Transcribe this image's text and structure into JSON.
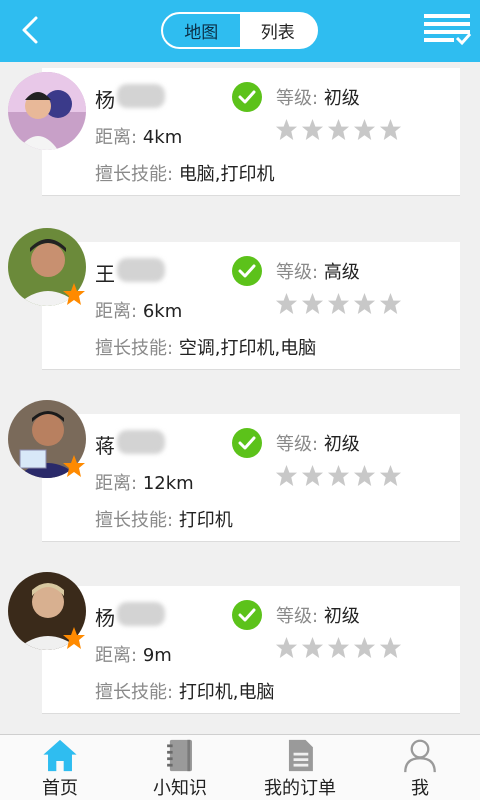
{
  "header": {
    "segments": [
      {
        "label": "地图",
        "active": true
      },
      {
        "label": "列表",
        "active": false
      }
    ],
    "accent_color": "#2fbdf0"
  },
  "technicians": [
    {
      "name_prefix": "杨",
      "name_blurred": true,
      "level_label": "等级:",
      "level": "初级",
      "distance_label": "距离:",
      "distance": "4km",
      "rating": 0,
      "skills_label": "擅长技能:",
      "skills": "电脑,打印机",
      "starred": false
    },
    {
      "name_prefix": "王",
      "name_blurred": true,
      "level_label": "等级:",
      "level": "高级",
      "distance_label": "距离:",
      "distance": "6km",
      "rating": 0,
      "skills_label": "擅长技能:",
      "skills": "空调,打印机,电脑",
      "starred": true
    },
    {
      "name_prefix": "蒋",
      "name_blurred": true,
      "level_label": "等级:",
      "level": "初级",
      "distance_label": "距离:",
      "distance": "12km",
      "rating": 0,
      "skills_label": "擅长技能:",
      "skills": "打印机",
      "starred": true
    },
    {
      "name_prefix": "杨",
      "name_blurred": true,
      "level_label": "等级:",
      "level": "初级",
      "distance_label": "距离:",
      "distance": "9m",
      "rating": 0,
      "skills_label": "擅长技能:",
      "skills": "打印机,电脑",
      "starred": true
    }
  ],
  "tabbar": {
    "items": [
      {
        "label": "首页",
        "icon": "home-icon",
        "active": true
      },
      {
        "label": "小知识",
        "icon": "notebook-icon",
        "active": false
      },
      {
        "label": "我的订单",
        "icon": "order-doc-icon",
        "active": false
      },
      {
        "label": "我",
        "icon": "user-icon",
        "active": false
      }
    ],
    "active_color": "#2fbdf0"
  }
}
